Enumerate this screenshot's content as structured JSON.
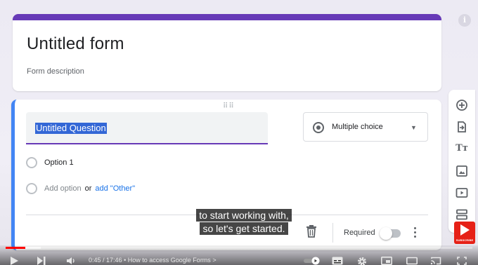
{
  "form": {
    "title": "Untitled form",
    "description_placeholder": "Form description"
  },
  "question": {
    "title": "Untitled Question",
    "type": "Multiple choice",
    "options": [
      {
        "label": "Option 1"
      }
    ],
    "add_option_label": "Add option",
    "or_label": "or",
    "add_other_label": "add \"Other\"",
    "required_label": "Required",
    "required": false
  },
  "side_toolbar": {
    "tools": [
      "add-question-icon",
      "import-questions-icon",
      "add-title-icon",
      "add-image-icon",
      "add-video-icon",
      "add-section-icon"
    ],
    "add_title_glyph": "Tт"
  },
  "subtitle": {
    "lines": [
      "to start working with,",
      "so let's get started."
    ]
  },
  "player": {
    "current_time": "0:45",
    "duration": "17:46",
    "chapter": "How to access Google Forms",
    "chapter_separator": "•",
    "chapter_chevron": ">",
    "progress_fraction": 0.042,
    "buffer_fraction": 0.075,
    "subscribe_label": "SUBSCRIBE"
  },
  "colors": {
    "accent_purple": "#673ab7",
    "focus_blue": "#4285f4",
    "link_blue": "#1a73e8",
    "progress_red": "#ff0000"
  }
}
